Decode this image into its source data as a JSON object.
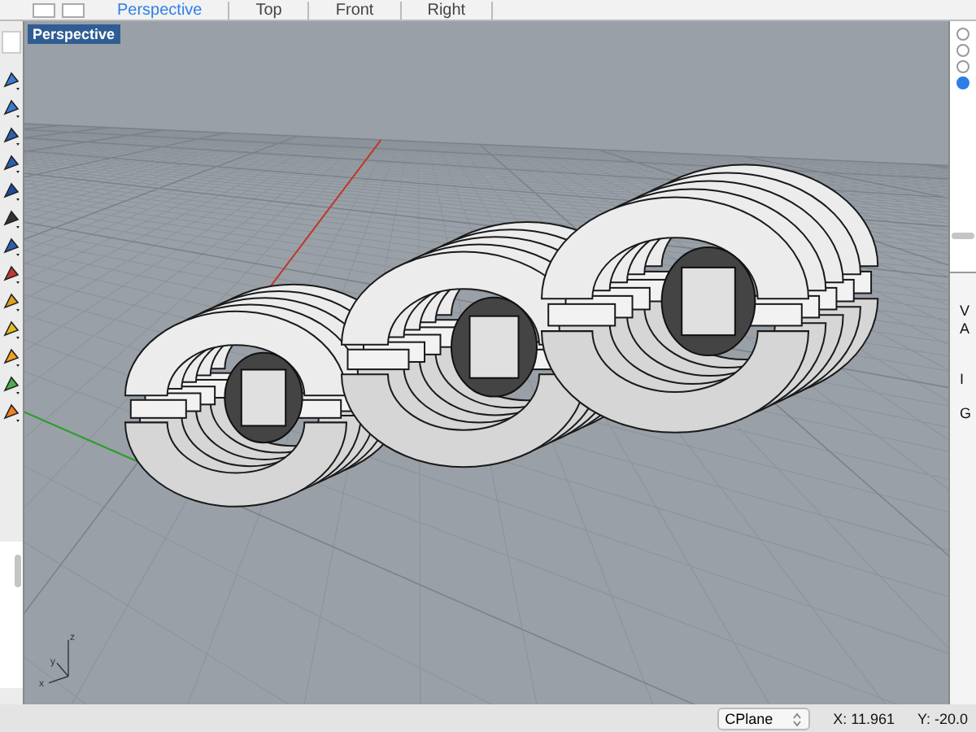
{
  "view_tabs": [
    {
      "label": "Perspective",
      "selected": true
    },
    {
      "label": "Top",
      "selected": false
    },
    {
      "label": "Front",
      "selected": false
    },
    {
      "label": "Right",
      "selected": false
    }
  ],
  "viewport": {
    "title": "Perspective",
    "axis_labels": [
      "z",
      "y",
      "x"
    ]
  },
  "right_panel": {
    "radios": [
      {
        "selected": false
      },
      {
        "selected": false
      },
      {
        "selected": false
      },
      {
        "selected": true
      }
    ],
    "labels": [
      "V",
      "A",
      "I",
      "G"
    ]
  },
  "status_bar": {
    "cplane": "CPlane",
    "x": "X: 11.961",
    "y": "Y: -20.0"
  }
}
